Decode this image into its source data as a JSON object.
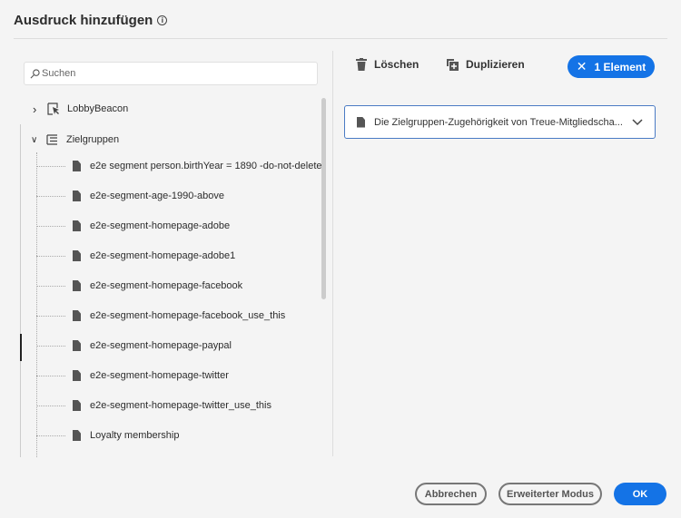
{
  "dialog": {
    "title": "Ausdruck hinzufügen",
    "info_icon": "info-icon"
  },
  "search": {
    "placeholder": "Suchen"
  },
  "tree": {
    "nodes": [
      {
        "label": "LobbyBeacon",
        "expanded": false
      },
      {
        "label": "Zielgruppen",
        "expanded": true
      }
    ],
    "items": [
      "e2e segment person.birthYear = 1890 -do-not-delete",
      "e2e-segment-age-1990-above",
      "e2e-segment-homepage-adobe",
      "e2e-segment-homepage-adobe1",
      "e2e-segment-homepage-facebook",
      "e2e-segment-homepage-facebook_use_this",
      "e2e-segment-homepage-paypal",
      "e2e-segment-homepage-twitter",
      "e2e-segment-homepage-twitter_use_this",
      "Loyalty membership"
    ]
  },
  "toolbar": {
    "delete": "Löschen",
    "duplicate": "Duplizieren",
    "selection": "1 Element"
  },
  "selected": {
    "label": "Die Zielgruppen-Zugehörigkeit von Treue-Mitgliedscha..."
  },
  "footer": {
    "cancel": "Abbrechen",
    "advanced": "Erweiterter Modus",
    "ok": "OK"
  },
  "colors": {
    "accent": "#1473e6"
  }
}
